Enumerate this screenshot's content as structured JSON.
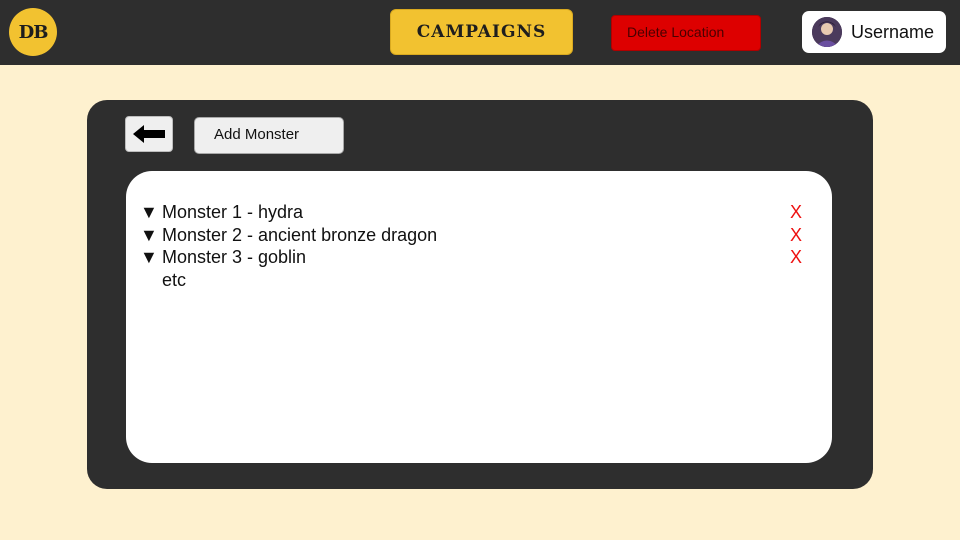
{
  "header": {
    "logo_text": "DB",
    "campaigns_label": "CAMPAIGNS",
    "delete_location_label": "Delete Location",
    "username": "Username"
  },
  "panel": {
    "add_monster_label": "Add Monster",
    "monsters": [
      {
        "toggle": "▼",
        "label": "Monster 1 - hydra",
        "remove": "X"
      },
      {
        "toggle": "▼",
        "label": "Monster 2 - ancient bronze dragon",
        "remove": "X"
      },
      {
        "toggle": "▼",
        "label": "Monster 3 - goblin",
        "remove": "X"
      }
    ],
    "more_text": "etc"
  },
  "colors": {
    "topbar": "#2e2e2e",
    "background": "#fef1cf",
    "accent_yellow": "#f2c230",
    "danger_red": "#dd0000",
    "remove_red": "#ee1111"
  },
  "icons": {
    "back": "arrow-left-icon",
    "avatar": "user-avatar-icon"
  }
}
